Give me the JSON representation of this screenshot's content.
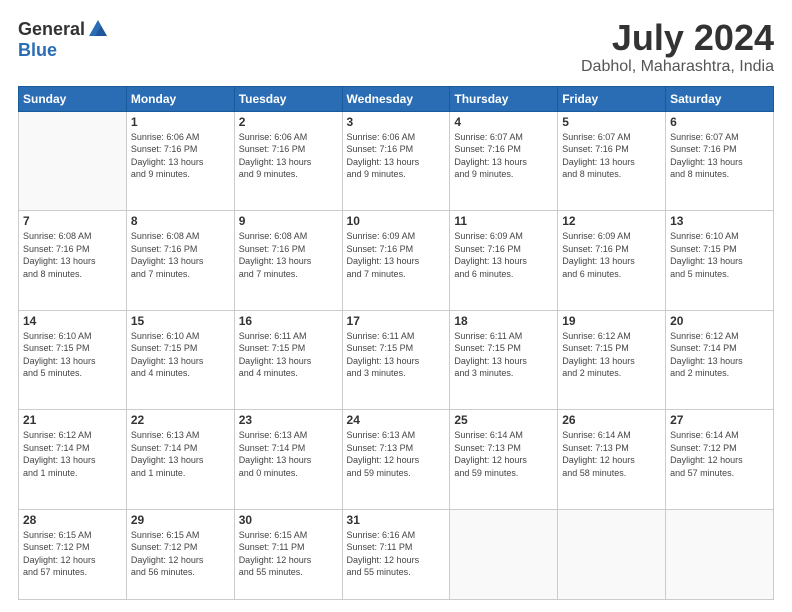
{
  "logo": {
    "general": "General",
    "blue": "Blue"
  },
  "header": {
    "month": "July 2024",
    "location": "Dabhol, Maharashtra, India"
  },
  "weekdays": [
    "Sunday",
    "Monday",
    "Tuesday",
    "Wednesday",
    "Thursday",
    "Friday",
    "Saturday"
  ],
  "weeks": [
    [
      {
        "day": "",
        "info": ""
      },
      {
        "day": "1",
        "info": "Sunrise: 6:06 AM\nSunset: 7:16 PM\nDaylight: 13 hours\nand 9 minutes."
      },
      {
        "day": "2",
        "info": "Sunrise: 6:06 AM\nSunset: 7:16 PM\nDaylight: 13 hours\nand 9 minutes."
      },
      {
        "day": "3",
        "info": "Sunrise: 6:06 AM\nSunset: 7:16 PM\nDaylight: 13 hours\nand 9 minutes."
      },
      {
        "day": "4",
        "info": "Sunrise: 6:07 AM\nSunset: 7:16 PM\nDaylight: 13 hours\nand 9 minutes."
      },
      {
        "day": "5",
        "info": "Sunrise: 6:07 AM\nSunset: 7:16 PM\nDaylight: 13 hours\nand 8 minutes."
      },
      {
        "day": "6",
        "info": "Sunrise: 6:07 AM\nSunset: 7:16 PM\nDaylight: 13 hours\nand 8 minutes."
      }
    ],
    [
      {
        "day": "7",
        "info": "Sunrise: 6:08 AM\nSunset: 7:16 PM\nDaylight: 13 hours\nand 8 minutes."
      },
      {
        "day": "8",
        "info": "Sunrise: 6:08 AM\nSunset: 7:16 PM\nDaylight: 13 hours\nand 7 minutes."
      },
      {
        "day": "9",
        "info": "Sunrise: 6:08 AM\nSunset: 7:16 PM\nDaylight: 13 hours\nand 7 minutes."
      },
      {
        "day": "10",
        "info": "Sunrise: 6:09 AM\nSunset: 7:16 PM\nDaylight: 13 hours\nand 7 minutes."
      },
      {
        "day": "11",
        "info": "Sunrise: 6:09 AM\nSunset: 7:16 PM\nDaylight: 13 hours\nand 6 minutes."
      },
      {
        "day": "12",
        "info": "Sunrise: 6:09 AM\nSunset: 7:16 PM\nDaylight: 13 hours\nand 6 minutes."
      },
      {
        "day": "13",
        "info": "Sunrise: 6:10 AM\nSunset: 7:15 PM\nDaylight: 13 hours\nand 5 minutes."
      }
    ],
    [
      {
        "day": "14",
        "info": "Sunrise: 6:10 AM\nSunset: 7:15 PM\nDaylight: 13 hours\nand 5 minutes."
      },
      {
        "day": "15",
        "info": "Sunrise: 6:10 AM\nSunset: 7:15 PM\nDaylight: 13 hours\nand 4 minutes."
      },
      {
        "day": "16",
        "info": "Sunrise: 6:11 AM\nSunset: 7:15 PM\nDaylight: 13 hours\nand 4 minutes."
      },
      {
        "day": "17",
        "info": "Sunrise: 6:11 AM\nSunset: 7:15 PM\nDaylight: 13 hours\nand 3 minutes."
      },
      {
        "day": "18",
        "info": "Sunrise: 6:11 AM\nSunset: 7:15 PM\nDaylight: 13 hours\nand 3 minutes."
      },
      {
        "day": "19",
        "info": "Sunrise: 6:12 AM\nSunset: 7:15 PM\nDaylight: 13 hours\nand 2 minutes."
      },
      {
        "day": "20",
        "info": "Sunrise: 6:12 AM\nSunset: 7:14 PM\nDaylight: 13 hours\nand 2 minutes."
      }
    ],
    [
      {
        "day": "21",
        "info": "Sunrise: 6:12 AM\nSunset: 7:14 PM\nDaylight: 13 hours\nand 1 minute."
      },
      {
        "day": "22",
        "info": "Sunrise: 6:13 AM\nSunset: 7:14 PM\nDaylight: 13 hours\nand 1 minute."
      },
      {
        "day": "23",
        "info": "Sunrise: 6:13 AM\nSunset: 7:14 PM\nDaylight: 13 hours\nand 0 minutes."
      },
      {
        "day": "24",
        "info": "Sunrise: 6:13 AM\nSunset: 7:13 PM\nDaylight: 12 hours\nand 59 minutes."
      },
      {
        "day": "25",
        "info": "Sunrise: 6:14 AM\nSunset: 7:13 PM\nDaylight: 12 hours\nand 59 minutes."
      },
      {
        "day": "26",
        "info": "Sunrise: 6:14 AM\nSunset: 7:13 PM\nDaylight: 12 hours\nand 58 minutes."
      },
      {
        "day": "27",
        "info": "Sunrise: 6:14 AM\nSunset: 7:12 PM\nDaylight: 12 hours\nand 57 minutes."
      }
    ],
    [
      {
        "day": "28",
        "info": "Sunrise: 6:15 AM\nSunset: 7:12 PM\nDaylight: 12 hours\nand 57 minutes."
      },
      {
        "day": "29",
        "info": "Sunrise: 6:15 AM\nSunset: 7:12 PM\nDaylight: 12 hours\nand 56 minutes."
      },
      {
        "day": "30",
        "info": "Sunrise: 6:15 AM\nSunset: 7:11 PM\nDaylight: 12 hours\nand 55 minutes."
      },
      {
        "day": "31",
        "info": "Sunrise: 6:16 AM\nSunset: 7:11 PM\nDaylight: 12 hours\nand 55 minutes."
      },
      {
        "day": "",
        "info": ""
      },
      {
        "day": "",
        "info": ""
      },
      {
        "day": "",
        "info": ""
      }
    ]
  ]
}
